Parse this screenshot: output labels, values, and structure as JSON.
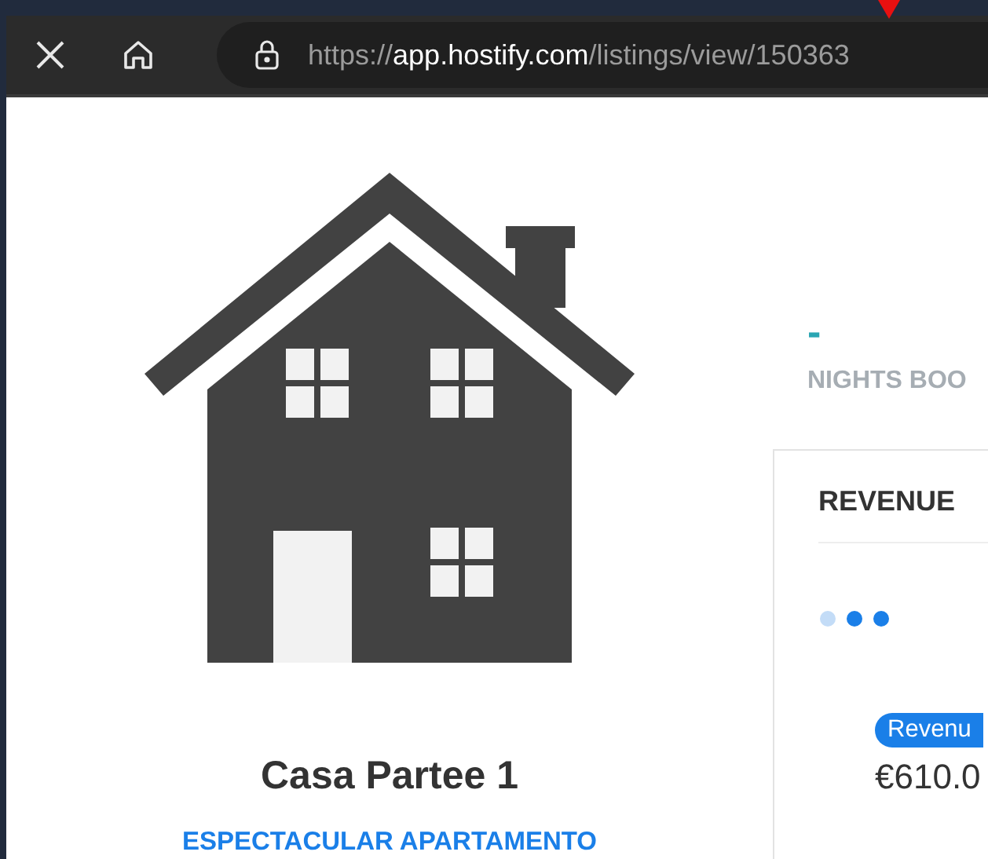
{
  "browser": {
    "url": {
      "scheme": "https://",
      "host": "app.hostify.com",
      "path": "/listings/view/150363"
    }
  },
  "listing": {
    "title": "Casa Partee 1",
    "subtitle": "ESPECTACULAR APARTAMENTO"
  },
  "stats": {
    "value": "-",
    "label": "NIGHTS BOO"
  },
  "revenue_card": {
    "title": "REVENUE",
    "badge": "Revenu",
    "amount": "€610.0"
  }
}
